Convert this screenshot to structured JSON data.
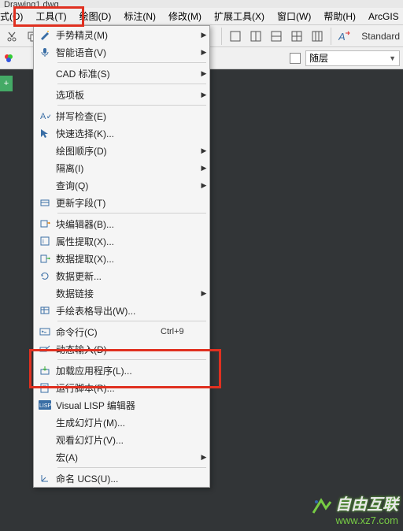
{
  "title": "Drawing1.dwg",
  "menubar": {
    "items": [
      {
        "label": "式(O)"
      },
      {
        "label": "工具(T)"
      },
      {
        "label": "绘图(D)"
      },
      {
        "label": "标注(N)"
      },
      {
        "label": "修改(M)"
      },
      {
        "label": "扩展工具(X)"
      },
      {
        "label": "窗口(W)"
      },
      {
        "label": "帮助(H)"
      },
      {
        "label": "ArcGIS"
      }
    ]
  },
  "toolbar": {
    "standard_label": "Standard"
  },
  "propbar": {
    "layer_combo": "随层",
    "tri": "▼"
  },
  "dropdown": {
    "items": [
      {
        "icon": "wizard",
        "label": "手势精灵(M)",
        "sub": true
      },
      {
        "icon": "voice",
        "label": "智能语音(V)",
        "sub": true
      },
      {
        "sep": true
      },
      {
        "icon": "",
        "label": "CAD 标准(S)",
        "sub": true
      },
      {
        "sep": true
      },
      {
        "icon": "",
        "label": "选项板",
        "sub": true
      },
      {
        "sep": true
      },
      {
        "icon": "spell",
        "label": "拼写检查(E)"
      },
      {
        "icon": "select",
        "label": "快速选择(K)..."
      },
      {
        "icon": "",
        "label": "绘图顺序(D)",
        "sub": true
      },
      {
        "icon": "",
        "label": "隔离(I)",
        "sub": true
      },
      {
        "icon": "",
        "label": "查询(Q)",
        "sub": true
      },
      {
        "icon": "field",
        "label": "更新字段(T)"
      },
      {
        "sep": true
      },
      {
        "icon": "block",
        "label": "块编辑器(B)..."
      },
      {
        "icon": "attr",
        "label": "属性提取(X)..."
      },
      {
        "icon": "dataex",
        "label": "数据提取(X)..."
      },
      {
        "icon": "refresh",
        "label": "数据更新..."
      },
      {
        "icon": "",
        "label": "数据链接",
        "sub": true
      },
      {
        "icon": "table",
        "label": "手绘表格导出(W)..."
      },
      {
        "sep": true
      },
      {
        "icon": "cmd",
        "label": "命令行(C)",
        "shortcut": "Ctrl+9"
      },
      {
        "icon": "dyn",
        "label": "动态输入(D)"
      },
      {
        "sep": true
      },
      {
        "icon": "load",
        "label": "加载应用程序(L)..."
      },
      {
        "icon": "script",
        "label": "运行脚本(R)..."
      },
      {
        "icon": "lisp",
        "label": "Visual LISP 编辑器"
      },
      {
        "icon": "",
        "label": "生成幻灯片(M)..."
      },
      {
        "icon": "",
        "label": "观看幻灯片(V)..."
      },
      {
        "icon": "",
        "label": "宏(A)",
        "sub": true
      },
      {
        "sep": true
      },
      {
        "icon": "ucs",
        "label": "命名 UCS(U)..."
      }
    ],
    "arrow": "▶"
  },
  "watermark": {
    "line1": "自由互联",
    "line2": "www.xz7.com"
  },
  "sidebar_tab": "+"
}
